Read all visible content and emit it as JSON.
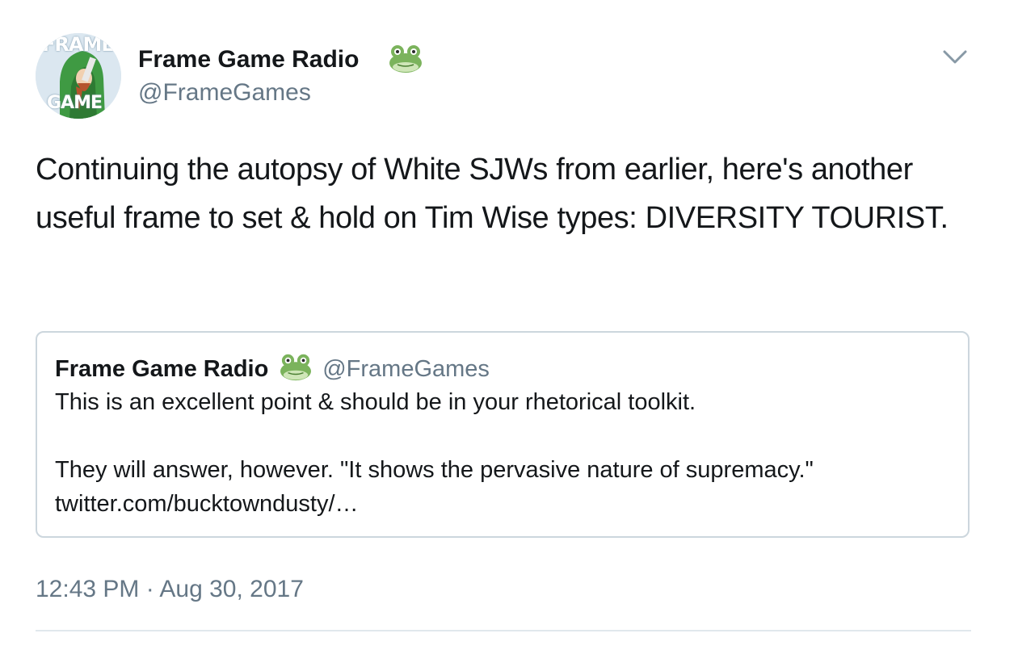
{
  "author": {
    "name": "Frame Game Radio",
    "handle": "@FrameGames",
    "name_emoji": "frog-face-icon",
    "avatar": {
      "text_top": "FRAME",
      "text_bottom": "GAME"
    }
  },
  "menu": {
    "icon": "chevron-down-icon"
  },
  "tweet": {
    "text": "Continuing the autopsy of White SJWs from earlier, here's another useful frame to set & hold on Tim Wise types: DIVERSITY TOURIST.",
    "timestamp": "12:43 PM · Aug 30, 2017"
  },
  "quoted_tweet": {
    "name": "Frame Game Radio",
    "handle": "@FrameGames",
    "line1": "This is an excellent point & should be in your rhetorical toolkit.",
    "line2": "They will answer, however. \"It shows the pervasive nature of supremacy.\"",
    "line3": "twitter.com/bucktowndusty/…"
  },
  "colors": {
    "text_primary": "#14171a",
    "text_secondary": "#657786",
    "border": "#ccd6dd",
    "frog_green": "#7bb35c"
  }
}
